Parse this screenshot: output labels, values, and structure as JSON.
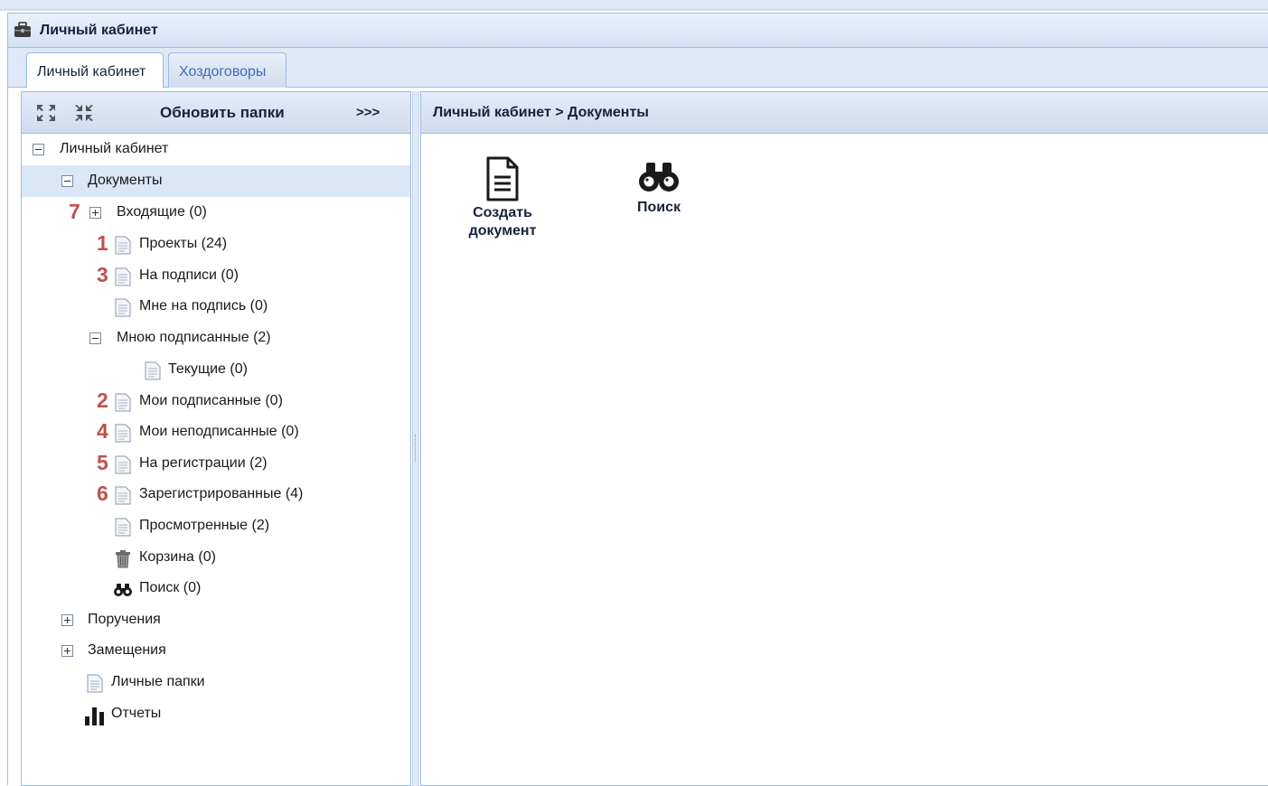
{
  "window": {
    "title": "Личный кабинет",
    "icon": "briefcase-icon"
  },
  "tabs": [
    {
      "label": "Личный кабинет",
      "active": true
    },
    {
      "label": "Хоздоговоры",
      "active": false
    }
  ],
  "toolbar": {
    "expand_icon": "expand-all-icon",
    "collapse_icon": "collapse-all-icon",
    "refresh_label": "Обновить папки",
    "more_label": ">>>"
  },
  "tree": {
    "root": "Личный кабинет",
    "documents": "Документы",
    "incoming": {
      "label": "Входящие (0)",
      "marker": "7"
    },
    "projects": {
      "label": "Проекты (24)",
      "marker": "1"
    },
    "on_signing": {
      "label": "На подписи (0)",
      "marker": "3"
    },
    "to_me_for_signing": {
      "label": "Мне на подпись (0)"
    },
    "signed_by_me": {
      "label": "Мною подписанные (2)"
    },
    "current": {
      "label": "Текущие (0)"
    },
    "my_signed": {
      "label": "Мои подписанные (0)",
      "marker": "2"
    },
    "my_unsigned": {
      "label": "Мои неподписанные (0)",
      "marker": "4"
    },
    "on_registration": {
      "label": "На регистрации (2)",
      "marker": "5"
    },
    "registered": {
      "label": "Зарегистрированные (4)",
      "marker": "6"
    },
    "viewed": {
      "label": "Просмотренные (2)"
    },
    "trash": {
      "label": "Корзина (0)"
    },
    "search": {
      "label": "Поиск (0)"
    },
    "assignments": "Поручения",
    "substitutions": "Замещения",
    "personal_folders": "Личные папки",
    "reports": "Отчеты"
  },
  "main": {
    "breadcrumb": "Личный кабинет > Документы",
    "actions": {
      "create_line1": "Создать",
      "create_line2": "документ",
      "search": "Поиск"
    }
  },
  "colors": {
    "accent": "#99bce8",
    "marker": "#c0504d",
    "selected_row": "#dae7f6"
  }
}
